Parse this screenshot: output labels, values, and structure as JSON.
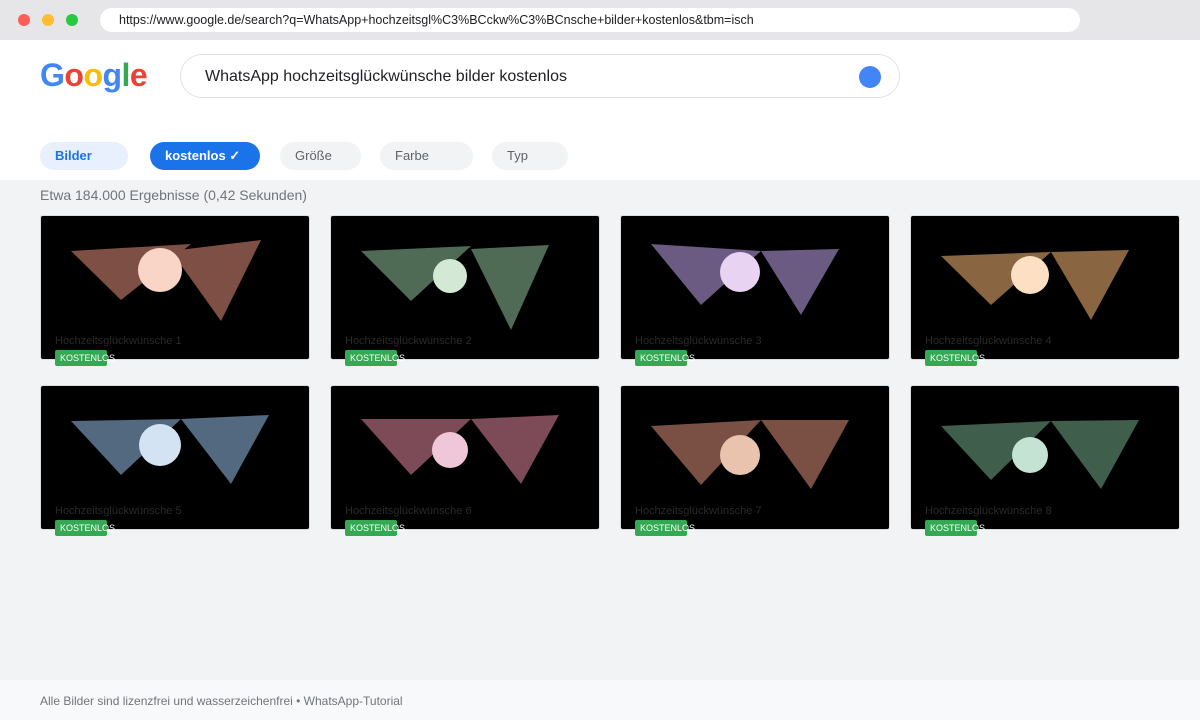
{
  "browser": {
    "url": "https://www.google.de/search?q=WhatsApp+hochzeitsgl%C3%BCckw%C3%BCnsche+bilder+kostenlos&tbm=isch"
  },
  "logo": {
    "letters": [
      {
        "char": "G",
        "color": "#4285f4"
      },
      {
        "char": "o",
        "color": "#ea4335"
      },
      {
        "char": "o",
        "color": "#fbbc05"
      },
      {
        "char": "g",
        "color": "#4285f4"
      },
      {
        "char": "l",
        "color": "#34a853"
      },
      {
        "char": "e",
        "color": "#ea4335"
      }
    ]
  },
  "search": {
    "query": "WhatsApp hochzeitsglückwünsche bilder kostenlos",
    "button_icon": "search-icon"
  },
  "filters": {
    "bilder": "Bilder",
    "kostenlos": "kostenlos ✓",
    "grosse": "Größe",
    "farbe": "Farbe",
    "typ": "Typ"
  },
  "results": {
    "stats": "Etwa 184.000 Ergebnisse (0,42 Sekunden)",
    "badge_label": "KOSTENLOS",
    "images": [
      {
        "title": "Hochzeitsglückwünsche 1",
        "shape_color": "#7e4f45",
        "circle_color": "#f9d5c7"
      },
      {
        "title": "Hochzeitsglückwünsche 2",
        "shape_color": "#4f6a55",
        "circle_color": "#d3e9d6"
      },
      {
        "title": "Hochzeitsglückwünsche 3",
        "shape_color": "#6b5a82",
        "circle_color": "#e8d3f2"
      },
      {
        "title": "Hochzeitsglückwünsche 4",
        "shape_color": "#896541",
        "circle_color": "#fde0c3"
      },
      {
        "title": "Hochzeitsglückwünsche 5",
        "shape_color": "#52697f",
        "circle_color": "#d4e3f3"
      },
      {
        "title": "Hochzeitsglückwünsche 6",
        "shape_color": "#7d4a58",
        "circle_color": "#f0c7d8"
      },
      {
        "title": "Hochzeitsglückwünsche 7",
        "shape_color": "#7b5044",
        "circle_color": "#eac3ae"
      },
      {
        "title": "Hochzeitsglückwünsche 8",
        "shape_color": "#3f5e4c",
        "circle_color": "#c5e3d3"
      }
    ]
  },
  "footer": {
    "text": "Alle Bilder sind lizenzfrei und wasserzeichenfrei • WhatsApp-Tutorial"
  }
}
